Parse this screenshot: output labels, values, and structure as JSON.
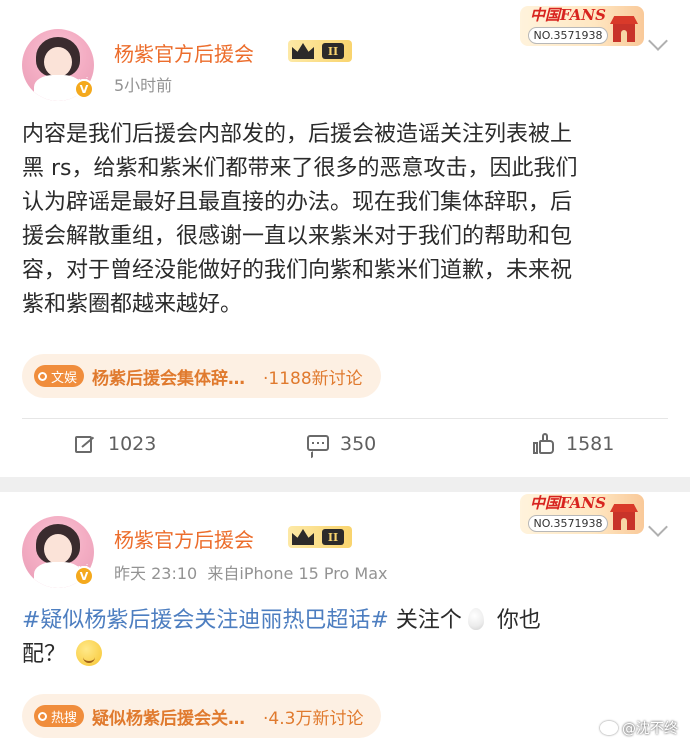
{
  "posts": [
    {
      "username": "杨紫官方后援会",
      "level_badge": "II",
      "time": "5小时前",
      "source": "",
      "fans_badge": {
        "title": "中国FANS",
        "number": "NO.3571938"
      },
      "content_lines": [
        "内容是我们后援会内部发的，后援会被造谣关注列表被上",
        "黑 rs，给紫和紫米们都带来了很多的恶意攻击，因此我们",
        "认为辟谣是最好且最直接的办法。现在我们集体辞职，后",
        "援会解散重组，很感谢一直以来紫米对于我们的帮助和包",
        "容，对于曾经没能做好的我们向紫和紫米们道歉，未来祝",
        "紫和紫圈都越来越好。"
      ],
      "topic": {
        "tag": "文娱",
        "title": "杨紫后援会集体辞…",
        "count": "·1188新讨论"
      },
      "actions": {
        "share": "1023",
        "comment": "350",
        "like": "1581"
      }
    },
    {
      "username": "杨紫官方后援会",
      "level_badge": "II",
      "time": "昨天 23:10",
      "source": "来自iPhone 15 Pro Max",
      "fans_badge": {
        "title": "中国FANS",
        "number": "NO.3571938"
      },
      "hashtag": "#疑似杨紫后援会关注迪丽热巴超话#",
      "content_after_tag": " 关注个",
      "content_tail": " 你也",
      "content_line2": "配？",
      "topic": {
        "tag": "热搜",
        "title": "疑似杨紫后援会关…",
        "count": "·4.3万新讨论"
      }
    }
  ],
  "watermark": "@沈不终",
  "colors": {
    "username": "#ec6d2c",
    "hashtag": "#4d7ec0",
    "topic_text": "#e07a2e"
  }
}
